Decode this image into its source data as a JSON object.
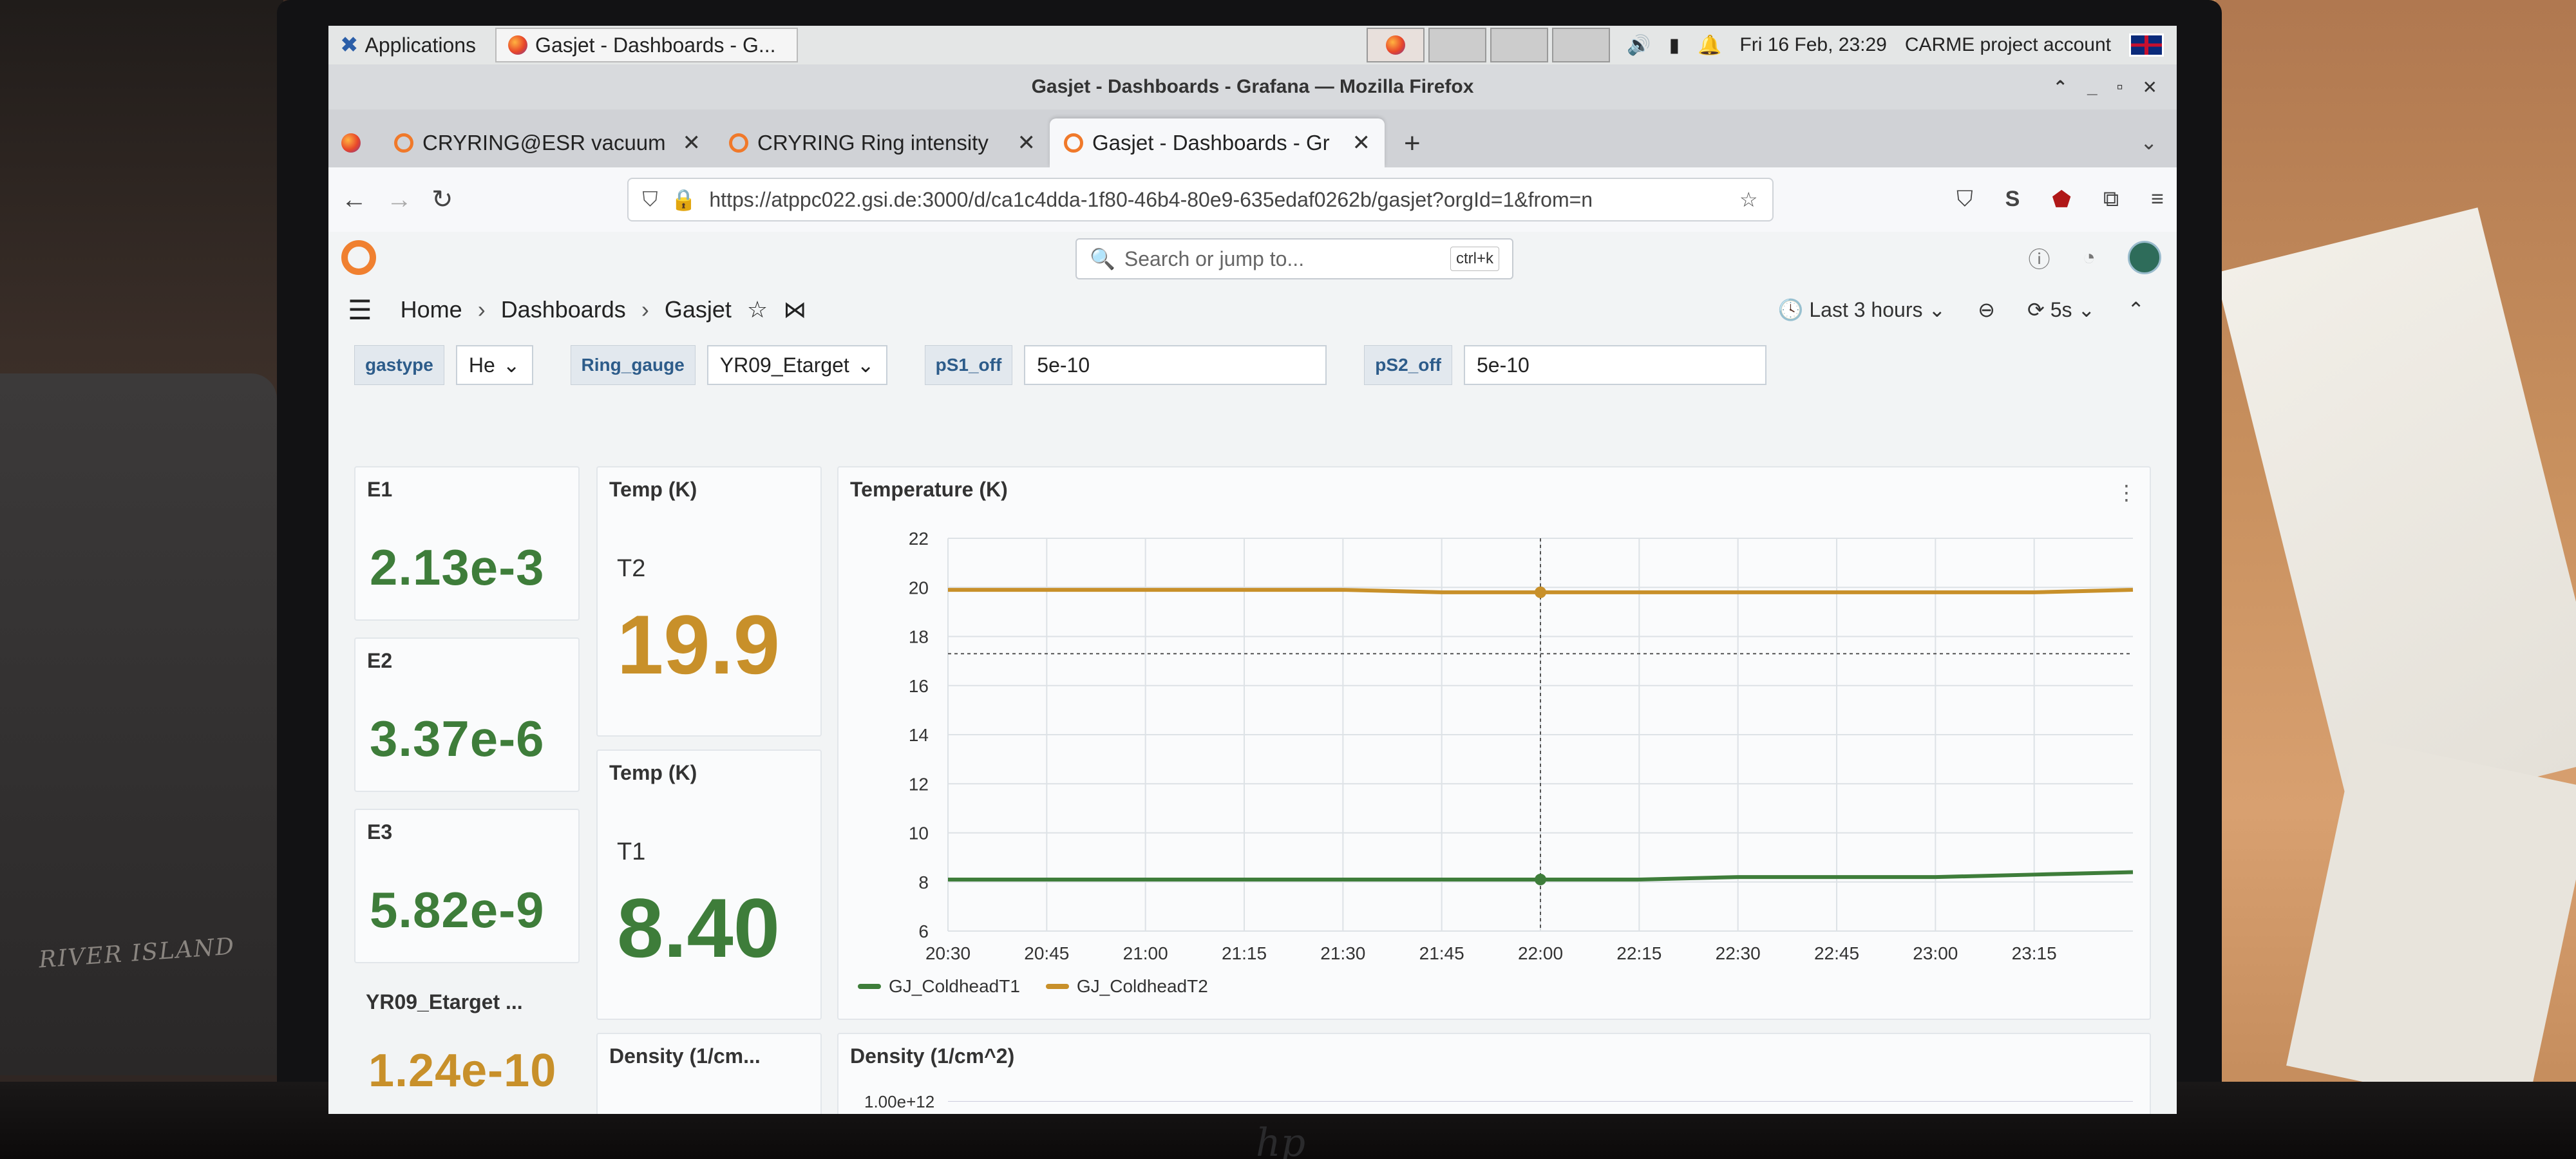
{
  "taskbar": {
    "applications": "Applications",
    "task_title": "Gasjet - Dashboards - G...",
    "datetime": "Fri 16 Feb, 23:29",
    "account": "CARME project account"
  },
  "firefox": {
    "window_title": "Gasjet - Dashboards - Grafana — Mozilla Firefox",
    "tabs": [
      {
        "label": "CRYRING@ESR vacuum"
      },
      {
        "label": "CRYRING Ring intensity"
      },
      {
        "label": "Gasjet - Dashboards - Gr"
      }
    ],
    "url": "https://atppc022.gsi.de:3000/d/ca1c4dda-1f80-46b4-80e9-635edaf0262b/gasjet?orgId=1&from=n"
  },
  "grafana": {
    "search_placeholder": "Search or jump to...",
    "search_shortcut": "ctrl+k",
    "breadcrumb": [
      "Home",
      "Dashboards",
      "Gasjet"
    ],
    "time_range": "Last 3 hours",
    "refresh": "5s",
    "variables": {
      "gastype_label": "gastype",
      "gastype_value": "He",
      "ring_gauge_label": "Ring_gauge",
      "ring_gauge_value": "YR09_Etarget",
      "ps1_label": "pS1_off",
      "ps1_value": "5e-10",
      "ps2_label": "pS2_off",
      "ps2_value": "5e-10"
    },
    "panels": {
      "e1": {
        "title": "E1",
        "value": "2.13e-3"
      },
      "e2": {
        "title": "E2",
        "value": "3.37e-6"
      },
      "e3": {
        "title": "E3",
        "value": "5.82e-9"
      },
      "yr09": {
        "title": "YR09_Etarget ...",
        "value": "1.24e-10"
      },
      "temp_t2": {
        "title": "Temp (K)",
        "sub": "T2",
        "value": "19.9"
      },
      "temp_t1": {
        "title": "Temp (K)",
        "sub": "T1",
        "value": "8.40"
      },
      "density_small": {
        "title": "Density (1/cm..."
      },
      "temperature_chart": {
        "title": "Temperature (K)"
      },
      "density_chart": {
        "title": "Density (1/cm^2)",
        "first_tick": "1.00e+12"
      }
    }
  },
  "chart_data": {
    "type": "line",
    "title": "Temperature (K)",
    "ylim": [
      6,
      22
    ],
    "yticks": [
      6,
      8,
      10,
      12,
      14,
      16,
      18,
      20,
      22
    ],
    "x": [
      "20:30",
      "20:45",
      "21:00",
      "21:15",
      "21:30",
      "21:45",
      "22:00",
      "22:15",
      "22:30",
      "22:45",
      "23:00",
      "23:15",
      "23:29"
    ],
    "xticks": [
      "20:30",
      "20:45",
      "21:00",
      "21:15",
      "21:30",
      "21:45",
      "22:00",
      "22:15",
      "22:30",
      "22:45",
      "23:00",
      "23:15"
    ],
    "series": [
      {
        "name": "GJ_ColdheadT1",
        "color": "#3e7d3a",
        "values": [
          8.1,
          8.1,
          8.1,
          8.1,
          8.1,
          8.1,
          8.1,
          8.1,
          8.2,
          8.2,
          8.2,
          8.3,
          8.4
        ]
      },
      {
        "name": "GJ_ColdheadT2",
        "color": "#c8902a",
        "values": [
          19.9,
          19.9,
          19.9,
          19.9,
          19.9,
          19.8,
          19.8,
          19.8,
          19.8,
          19.8,
          19.8,
          19.8,
          19.9
        ]
      }
    ],
    "grid": true,
    "legend": "bottom-left"
  }
}
